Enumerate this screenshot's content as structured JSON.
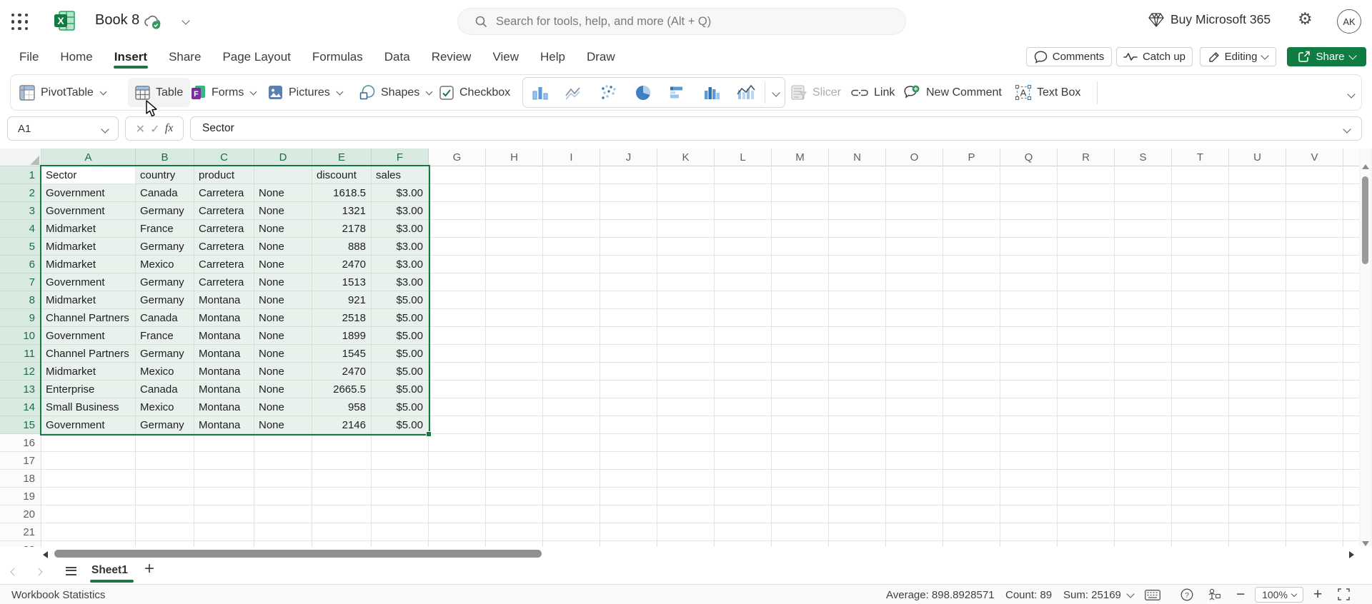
{
  "top_bar": {
    "title": "Book 8",
    "search_placeholder": "Search for tools, help, and more (Alt + Q)",
    "buy_label": "Buy Microsoft 365",
    "avatar_initials": "AK"
  },
  "menu": {
    "items": [
      {
        "label": "File",
        "active": false
      },
      {
        "label": "Home",
        "active": false
      },
      {
        "label": "Insert",
        "active": true
      },
      {
        "label": "Share",
        "active": false
      },
      {
        "label": "Page Layout",
        "active": false
      },
      {
        "label": "Formulas",
        "active": false
      },
      {
        "label": "Data",
        "active": false
      },
      {
        "label": "Review",
        "active": false
      },
      {
        "label": "View",
        "active": false
      },
      {
        "label": "Help",
        "active": false
      },
      {
        "label": "Draw",
        "active": false
      }
    ],
    "right": {
      "comments": "Comments",
      "catch_up": "Catch up",
      "editing": "Editing",
      "share": "Share"
    }
  },
  "ribbon": {
    "pivottable": "PivotTable",
    "table": "Table",
    "forms": "Forms",
    "pictures": "Pictures",
    "shapes": "Shapes",
    "checkbox": "Checkbox",
    "slicer": "Slicer",
    "link": "Link",
    "new_comment": "New Comment",
    "text_box": "Text Box"
  },
  "formula_bar": {
    "name_box": "A1",
    "fx_label": "fx",
    "content": "Sector"
  },
  "grid": {
    "columns": [
      "A",
      "B",
      "C",
      "D",
      "E",
      "F",
      "G",
      "H",
      "I",
      "J",
      "K",
      "L",
      "M",
      "N",
      "O",
      "P",
      "Q",
      "R",
      "S",
      "T",
      "U",
      "V"
    ],
    "visible_rows": 22,
    "selection_range": "A1:F15",
    "active_cell": "A1"
  },
  "sheet": {
    "rows": [
      [
        "Sector",
        "country",
        "product",
        "",
        "discount",
        "sales"
      ],
      [
        "Government",
        "Canada",
        "Carretera",
        "None",
        "1618.5",
        "$3.00"
      ],
      [
        "Government",
        "Germany",
        "Carretera",
        "None",
        "1321",
        "$3.00"
      ],
      [
        "Midmarket",
        "France",
        "Carretera",
        "None",
        "2178",
        "$3.00"
      ],
      [
        "Midmarket",
        "Germany",
        "Carretera",
        "None",
        "888",
        "$3.00"
      ],
      [
        "Midmarket",
        "Mexico",
        "Carretera",
        "None",
        "2470",
        "$3.00"
      ],
      [
        "Government",
        "Germany",
        "Carretera",
        "None",
        "1513",
        "$3.00"
      ],
      [
        "Midmarket",
        "Germany",
        "Montana",
        "None",
        "921",
        "$5.00"
      ],
      [
        "Channel Partners",
        "Canada",
        "Montana",
        "None",
        "2518",
        "$5.00"
      ],
      [
        "Government",
        "France",
        "Montana",
        "None",
        "1899",
        "$5.00"
      ],
      [
        "Channel Partners",
        "Germany",
        "Montana",
        "None",
        "1545",
        "$5.00"
      ],
      [
        "Midmarket",
        "Mexico",
        "Montana",
        "None",
        "2470",
        "$5.00"
      ],
      [
        "Enterprise",
        "Canada",
        "Montana",
        "None",
        "2665.5",
        "$5.00"
      ],
      [
        "Small Business",
        "Mexico",
        "Montana",
        "None",
        "958",
        "$5.00"
      ],
      [
        "Government",
        "Germany",
        "Montana",
        "None",
        "2146",
        "$5.00"
      ]
    ]
  },
  "sheet_tabs": {
    "active_tab": "Sheet1"
  },
  "status_bar": {
    "left": "Workbook Statistics",
    "average": "Average: 898.8928571",
    "count": "Count: 89",
    "sum": "Sum: 25169",
    "zoom": "100%"
  },
  "colors": {
    "brand_green": "#107c41",
    "selection_fill": "#e9f1ec",
    "header_selected_fill": "#d9eae0"
  }
}
